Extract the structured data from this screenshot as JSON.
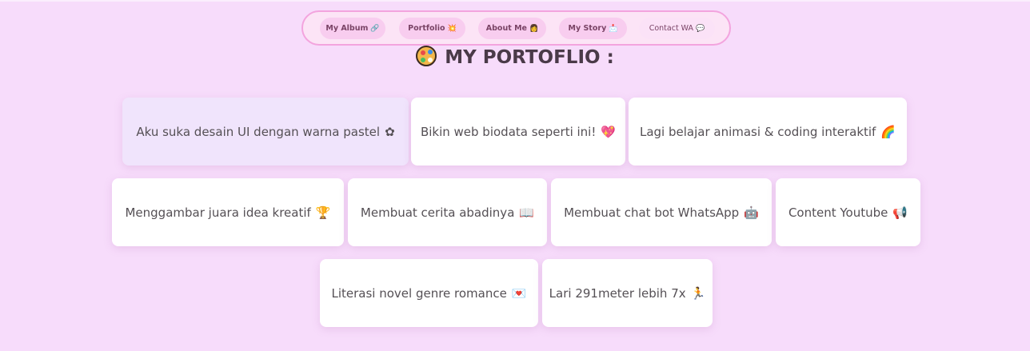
{
  "nav": {
    "items": [
      {
        "label": "My Album",
        "icon": "🔗"
      },
      {
        "label": "Portfolio",
        "icon": "💥"
      },
      {
        "label": "About Me",
        "icon": "👩"
      },
      {
        "label": "My Story",
        "icon": "📩"
      },
      {
        "label": "Contact WA",
        "icon": "💬"
      }
    ]
  },
  "page_title": "MY PORTOFLIO :",
  "cards": [
    {
      "text": "Aku suka desain UI dengan warna pastel",
      "icon": "✿"
    },
    {
      "text": "Bikin web biodata seperti ini!",
      "icon": "💖"
    },
    {
      "text": "Lagi belajar animasi & coding interaktif",
      "icon": "🌈"
    },
    {
      "text": "Menggambar juara idea kreatif",
      "icon": "🏆"
    },
    {
      "text": "Membuat cerita abadinya",
      "icon": "📖"
    },
    {
      "text": "Membuat chat bot WhatsApp",
      "icon": "🤖"
    },
    {
      "text": "Content Youtube",
      "icon": "📢"
    },
    {
      "text": "Literasi novel genre romance",
      "icon": "💌"
    },
    {
      "text": "Lari 291meter lebih 7x",
      "icon": "🏃"
    }
  ],
  "colors": {
    "background": "#f7dcfb",
    "nav_border": "#f3a4de",
    "card": "#ffffff",
    "card_active": "#f0e4fc"
  }
}
